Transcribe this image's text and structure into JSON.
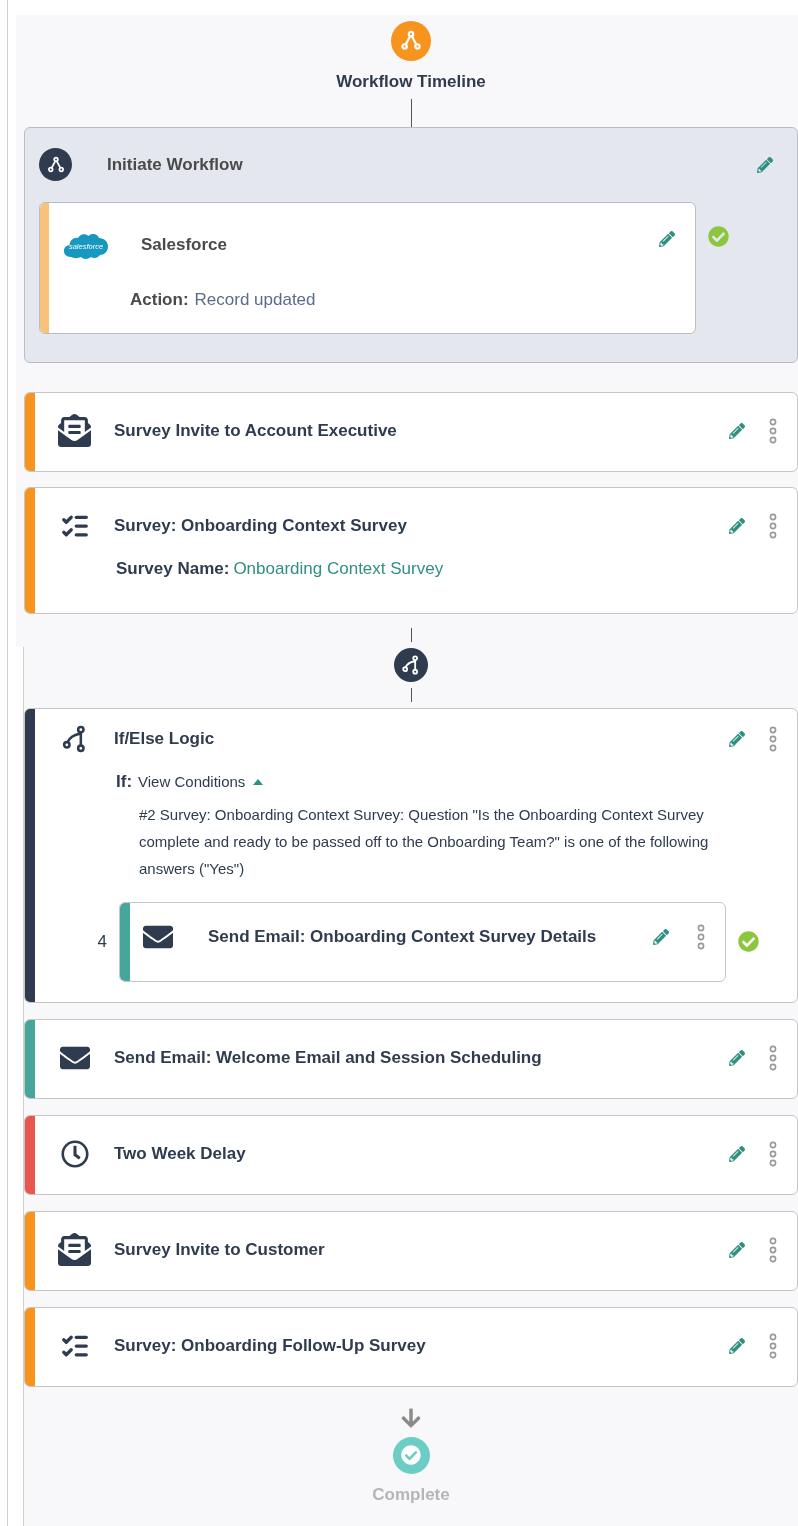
{
  "header": {
    "title": "Workflow Timeline"
  },
  "trigger": {
    "title": "Initiate Workflow",
    "integration": {
      "name": "Salesforce",
      "logo_text": "salesforce",
      "action_label": "Action:",
      "action_value": "Record updated",
      "complete": true,
      "color": "#f9c27a"
    }
  },
  "steps": [
    {
      "kind": "invite",
      "title": "Survey Invite to Account Executive",
      "color": "#f7941d"
    },
    {
      "kind": "survey",
      "title": "Survey: Onboarding Context Survey",
      "detail_label": "Survey Name:",
      "detail_value": "Onboarding Context Survey",
      "color": "#f7941d"
    }
  ],
  "logic": {
    "kind": "ifelse",
    "title": "If/Else Logic",
    "color": "#2f3b4e",
    "condition_label": "If:",
    "toggle": "View Conditions",
    "expanded": true,
    "condition": "#2 Survey: Onboarding Context Survey: Question \"Is the Onboarding Context Survey complete and ready to be passed off to the Onboarding Team?\" is one of the following answers (\"Yes\")",
    "children": [
      {
        "kind": "email",
        "number": "4",
        "title": "Send Email: Onboarding Context Survey Details",
        "color": "#46a69c",
        "complete": true
      }
    ]
  },
  "after_steps": [
    {
      "kind": "email",
      "title": "Send Email: Welcome Email and Session Scheduling",
      "color": "#46a69c"
    },
    {
      "kind": "delay",
      "title": "Two Week Delay",
      "color": "#e8574d"
    },
    {
      "kind": "invite",
      "title": "Survey Invite to Customer",
      "color": "#f7941d"
    },
    {
      "kind": "survey",
      "title": "Survey: Onboarding Follow-Up Survey",
      "color": "#f7941d"
    }
  ],
  "end": {
    "label": "Complete"
  }
}
